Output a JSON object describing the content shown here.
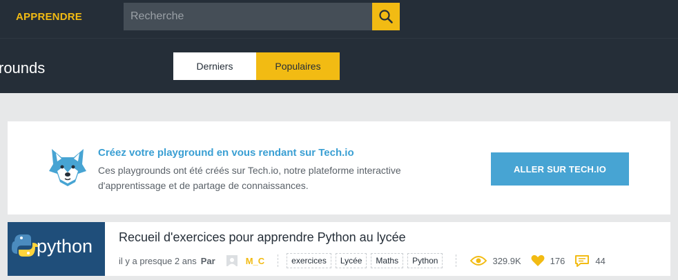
{
  "header": {
    "brand": "APPRENDRE",
    "search_placeholder": "Recherche",
    "search_icon": "search-icon"
  },
  "subheader": {
    "title": "rounds",
    "tabs": [
      {
        "label": "Derniers",
        "active": false
      },
      {
        "label": "Populaires",
        "active": true
      }
    ]
  },
  "promo": {
    "title": "Créez votre playground en vous rendant sur Tech.io",
    "text": "Ces playgrounds ont été créés sur Tech.io, notre plateforme interactive d'apprentissage et de partage de connaissances.",
    "button": "ALLER SUR TECH.IO",
    "mascot_icon": "fox-mascot-icon"
  },
  "playground": {
    "title": "Recueil d'exercices pour apprendre Python au lycée",
    "thumbnail_text": "python",
    "age": "il y a presque 2 ans",
    "by": "Par",
    "author": "M_C",
    "tags": [
      "exercices",
      "Lycée",
      "Maths",
      "Python"
    ],
    "views": "329.9K",
    "likes": "176",
    "comments": "44"
  },
  "colors": {
    "accent": "#f2bb13",
    "dark": "#252e38",
    "blue": "#47a4d3"
  }
}
